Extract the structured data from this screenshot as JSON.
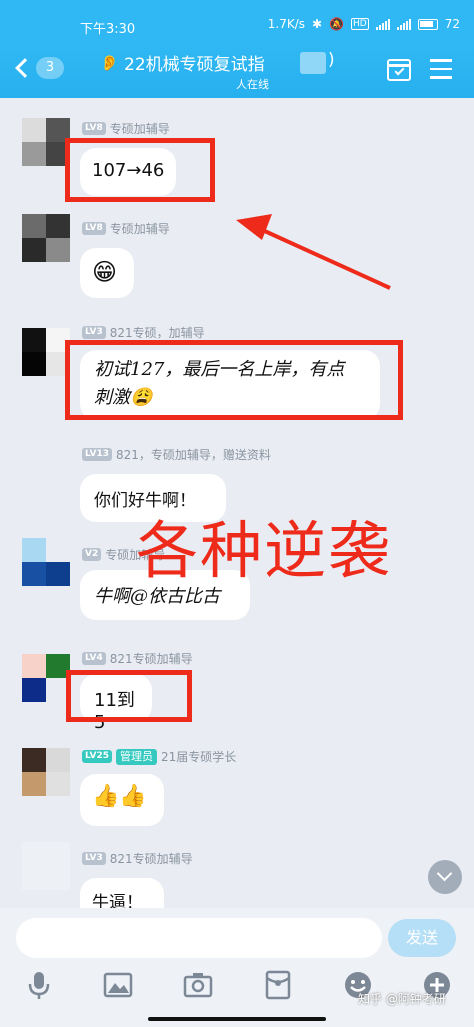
{
  "status_bar": {
    "time": "下午3:30",
    "speed": "1.7K/s",
    "battery": "72"
  },
  "header": {
    "back_badge": "3",
    "title": "22机械专硕复试指",
    "title_suffix": ")",
    "online": "人在线"
  },
  "messages": [
    {
      "level": "LV8",
      "tag": "专硕加辅导",
      "text": "107→46"
    },
    {
      "level": "LV8",
      "tag": "专硕加辅导",
      "text": "😁"
    },
    {
      "level": "LV3",
      "tag": "821专硕，加辅导",
      "text_line1": "初试127，最后一名上岸，有点",
      "text_line2": "刺激😩"
    },
    {
      "level": "LV13",
      "tag": "821，专硕加辅导，赠送资料",
      "text": "你们好牛啊！"
    },
    {
      "level": "V2",
      "tag": "专硕加辅导",
      "text": "牛啊@依古比古"
    },
    {
      "level": "LV4",
      "tag": "821专硕加辅导",
      "text": "11到5"
    },
    {
      "level": "LV25",
      "role": "管理员",
      "tag": "21届专硕学长",
      "text": "👍👍"
    },
    {
      "level": "LV3",
      "tag": "821专硕加辅导",
      "text": "牛逼！"
    }
  ],
  "overlay_text": "各种逆袭",
  "input": {
    "placeholder": "",
    "send_label": "发送"
  },
  "toolbar_icons": [
    "microphone-icon",
    "image-icon",
    "camera-icon",
    "red-packet-icon",
    "emoji-icon",
    "plus-icon"
  ],
  "watermark": "知乎 @阿钟考研",
  "colors": {
    "header_blue": "#2fb8f3",
    "highlight_red": "#ee2a1a",
    "admin_teal": "#36c9c0",
    "chat_background": "#e9edf3"
  }
}
